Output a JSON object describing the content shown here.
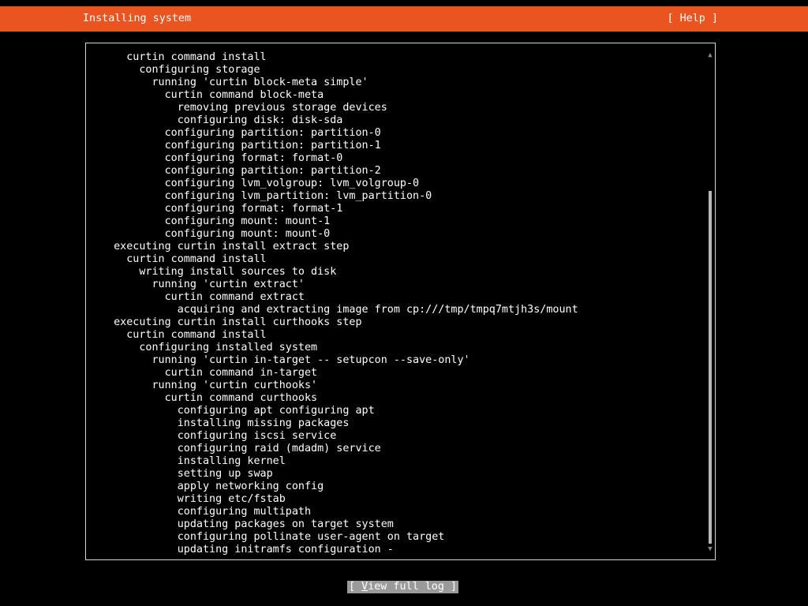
{
  "header": {
    "title": "Installing system",
    "help_label": "[ Help ]"
  },
  "log": {
    "lines": [
      "    curtin command install",
      "      configuring storage",
      "        running 'curtin block-meta simple'",
      "          curtin command block-meta",
      "            removing previous storage devices",
      "            configuring disk: disk-sda",
      "          configuring partition: partition-0",
      "          configuring partition: partition-1",
      "          configuring format: format-0",
      "          configuring partition: partition-2",
      "          configuring lvm_volgroup: lvm_volgroup-0",
      "          configuring lvm_partition: lvm_partition-0",
      "          configuring format: format-1",
      "          configuring mount: mount-1",
      "          configuring mount: mount-0",
      "  executing curtin install extract step",
      "    curtin command install",
      "      writing install sources to disk",
      "        running 'curtin extract'",
      "          curtin command extract",
      "            acquiring and extracting image from cp:///tmp/tmpq7mtjh3s/mount",
      "  executing curtin install curthooks step",
      "    curtin command install",
      "      configuring installed system",
      "        running 'curtin in-target -- setupcon --save-only'",
      "          curtin command in-target",
      "        running 'curtin curthooks'",
      "          curtin command curthooks",
      "            configuring apt configuring apt",
      "            installing missing packages",
      "            configuring iscsi service",
      "            configuring raid (mdadm) service",
      "            installing kernel",
      "            setting up swap",
      "            apply networking config",
      "            writing etc/fstab",
      "            configuring multipath",
      "            updating packages on target system",
      "            configuring pollinate user-agent on target",
      "            updating initramfs configuration -"
    ],
    "scroll_position": 0.6
  },
  "scrollbar": {
    "up_icon": "▲",
    "down_icon": "▼"
  },
  "footer": {
    "view_log_prefix": "[ ",
    "view_log_hotkey": "V",
    "view_log_rest": "iew full log ]"
  },
  "colors": {
    "accent": "#e95420",
    "background": "#000000",
    "text": "#ffffff",
    "button_focus": "#9a9a9a"
  }
}
